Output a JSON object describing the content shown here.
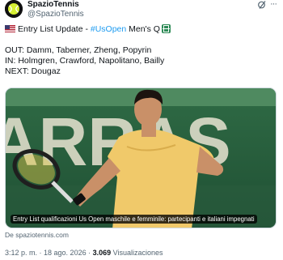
{
  "author": {
    "display_name": "SpazioTennis",
    "handle": "@SpazioTennis",
    "avatar_icon": "tennis-ball-logo-icon"
  },
  "tweet": {
    "line1_prefix": "Entry List Update - ",
    "line1_hashtag": "#UsOpen",
    "line1_suffix": " Men's Q",
    "out_line": "OUT: Damm, Taberner, Zheng, Popyrin",
    "in_line": "IN: Holmgren, Crawford, Napolitano, Bailly",
    "next_line": "NEXT: Dougaz"
  },
  "media": {
    "caption": "Entry List qualificazioni Us Open maschile e femminile: partecipanti e italiani impegnati",
    "background_text": "ARRAS"
  },
  "source": {
    "label": "De spaziotennis.com"
  },
  "meta": {
    "time": "3:12 p. m.",
    "separator1": " · ",
    "date": "18 ago. 2026",
    "separator2": " · ",
    "views_count": "3.069",
    "views_label": " Visualizaciones"
  },
  "colors": {
    "link": "#1d9bf0",
    "muted": "#536471",
    "text": "#0f1419"
  }
}
